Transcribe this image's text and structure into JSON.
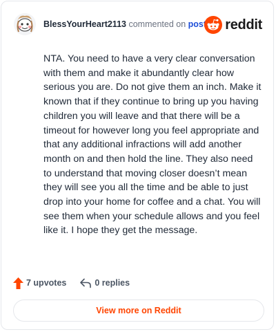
{
  "header": {
    "username": "BlessYourHeart2113",
    "commented_on": "commented on",
    "post_link": "post",
    "brand_word": "reddit"
  },
  "comment": {
    "text": "NTA. You need to have a very clear conversation with them and make it abundantly clear how serious you are. Do not give them an inch. Make it known that if they continue to bring up you having children you will leave and that there will be a timeout for however long you feel appropriate and that any additional infractions will add another month on and then hold the line. They also need to understand that moving closer doesn’t mean they will see you all the time and be able to just drop into your home for coffee and a chat. You will see them when your schedule allows and you feel like it. I hope they get the message."
  },
  "actions": {
    "upvotes": "7 upvotes",
    "replies": "0 replies"
  },
  "footer": {
    "view_more": "View more on Reddit"
  },
  "colors": {
    "brand": "#ff4500",
    "link": "#1d4ed8",
    "upvote_arrow": "#ff4500"
  },
  "icons": {
    "avatar": "snoo-avatar-icon",
    "brand": "reddit-logo-icon",
    "upvote": "upvote-arrow-icon",
    "reply": "reply-arrow-icon"
  }
}
